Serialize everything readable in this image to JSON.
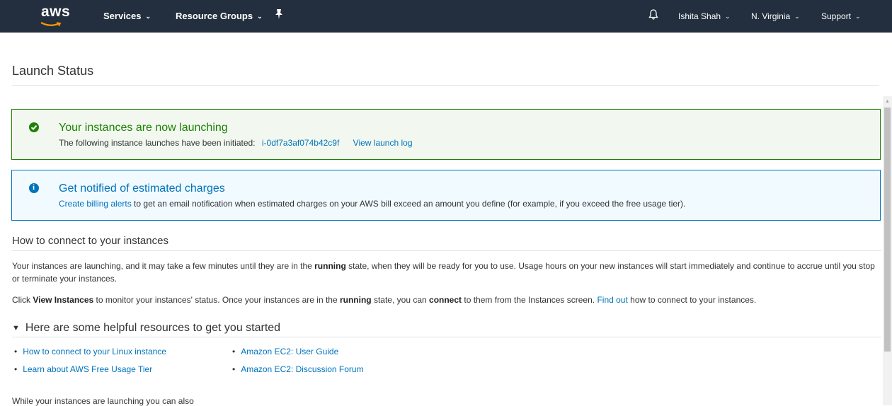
{
  "nav": {
    "logo": "aws",
    "services": "Services",
    "resource_groups": "Resource Groups",
    "user": "Ishita Shah",
    "region": "N. Virginia",
    "support": "Support"
  },
  "page": {
    "title": "Launch Status"
  },
  "success_box": {
    "title": "Your instances are now launching",
    "text": "The following instance launches have been initiated:",
    "instance_id": "i-0df7a3af074b42c9f",
    "view_log": "View launch log"
  },
  "info_box": {
    "title": "Get notified of estimated charges",
    "link": "Create billing alerts",
    "text": " to get an email notification when estimated charges on your AWS bill exceed an amount you define (for example, if you exceed the free usage tier)."
  },
  "connect": {
    "heading": "How to connect to your instances",
    "p1_a": "Your instances are launching, and it may take a few minutes until they are in the ",
    "p1_bold": "running",
    "p1_b": " state, when they will be ready for you to use. Usage hours on your new instances will start immediately and continue to accrue until you stop or terminate your instances.",
    "p2_a": "Click ",
    "p2_bold1": "View Instances",
    "p2_b": " to monitor your instances' status. Once your instances are in the ",
    "p2_bold2": "running",
    "p2_c": " state, you can ",
    "p2_bold3": "connect",
    "p2_d": " to them from the Instances screen. ",
    "p2_link": "Find out",
    "p2_e": " how to connect to your instances."
  },
  "resources": {
    "heading": "Here are some helpful resources to get you started",
    "links": [
      "How to connect to your Linux instance",
      "Learn about AWS Free Usage Tier",
      "Amazon EC2: User Guide",
      "Amazon EC2: Discussion Forum"
    ]
  },
  "footer": {
    "text": "While your instances are launching you can also"
  }
}
